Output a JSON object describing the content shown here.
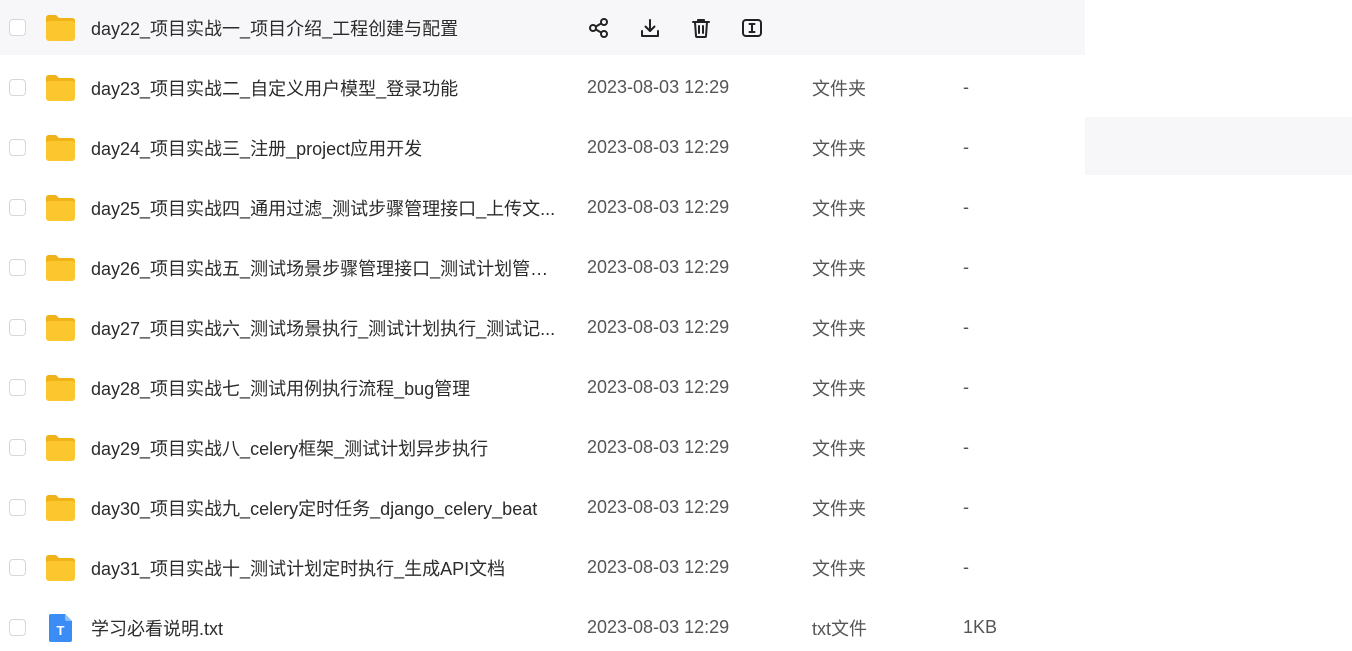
{
  "row_actions": {
    "share_icon": "share-icon",
    "download_icon": "download-icon",
    "delete_icon": "trash-icon",
    "rename_icon": "rename-icon"
  },
  "colors": {
    "folder": "#fcc72e",
    "txt_icon": "#3b8cf5",
    "hover_bg": "#f7f7f9"
  },
  "files": [
    {
      "name": "day22_项目实战一_项目介绍_工程创建与配置",
      "date": "",
      "kind": "",
      "size": "",
      "icon": "folder-icon",
      "hovered": true
    },
    {
      "name": "day23_项目实战二_自定义用户模型_登录功能",
      "date": "2023-08-03 12:29",
      "kind": "文件夹",
      "size": "-",
      "icon": "folder-icon"
    },
    {
      "name": "day24_项目实战三_注册_project应用开发",
      "date": "2023-08-03 12:29",
      "kind": "文件夹",
      "size": "-",
      "icon": "folder-icon"
    },
    {
      "name": "day25_项目实战四_通用过滤_测试步骤管理接口_上传文...",
      "date": "2023-08-03 12:29",
      "kind": "文件夹",
      "size": "-",
      "icon": "folder-icon"
    },
    {
      "name": "day26_项目实战五_测试场景步骤管理接口_测试计划管理...",
      "date": "2023-08-03 12:29",
      "kind": "文件夹",
      "size": "-",
      "icon": "folder-icon"
    },
    {
      "name": "day27_项目实战六_测试场景执行_测试计划执行_测试记...",
      "date": "2023-08-03 12:29",
      "kind": "文件夹",
      "size": "-",
      "icon": "folder-icon"
    },
    {
      "name": "day28_项目实战七_测试用例执行流程_bug管理",
      "date": "2023-08-03 12:29",
      "kind": "文件夹",
      "size": "-",
      "icon": "folder-icon"
    },
    {
      "name": "day29_项目实战八_celery框架_测试计划异步执行",
      "date": "2023-08-03 12:29",
      "kind": "文件夹",
      "size": "-",
      "icon": "folder-icon"
    },
    {
      "name": "day30_项目实战九_celery定时任务_django_celery_beat",
      "date": "2023-08-03 12:29",
      "kind": "文件夹",
      "size": "-",
      "icon": "folder-icon"
    },
    {
      "name": "day31_项目实战十_测试计划定时执行_生成API文档",
      "date": "2023-08-03 12:29",
      "kind": "文件夹",
      "size": "-",
      "icon": "folder-icon"
    },
    {
      "name": "学习必看说明.txt",
      "date": "2023-08-03 12:29",
      "kind": "txt文件",
      "size": "1KB",
      "icon": "txt-file-icon",
      "icon_letter": "T"
    }
  ]
}
